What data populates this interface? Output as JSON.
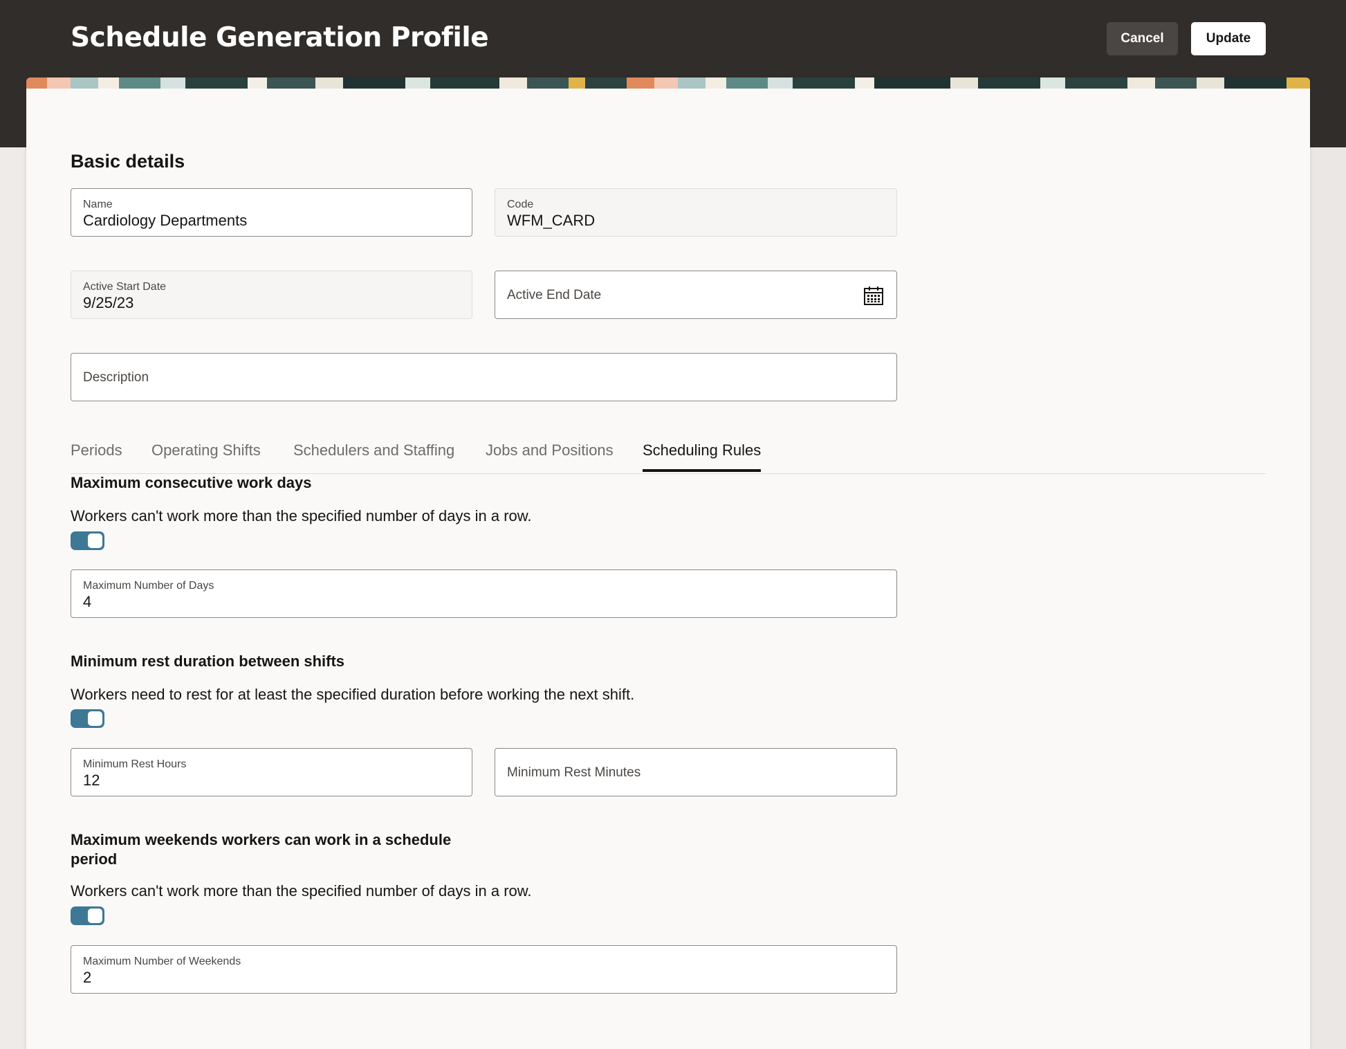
{
  "header": {
    "title": "Schedule Generation Profile",
    "cancel_label": "Cancel",
    "update_label": "Update"
  },
  "basic_details": {
    "title": "Basic details",
    "name": {
      "label": "Name",
      "value": "Cardiology Departments"
    },
    "code": {
      "label": "Code",
      "value": "WFM_CARD"
    },
    "active_start_date": {
      "label": "Active Start Date",
      "value": "9/25/23"
    },
    "active_end_date": {
      "placeholder": "Active End Date"
    },
    "description": {
      "placeholder": "Description"
    }
  },
  "tabs": [
    {
      "label": "Periods"
    },
    {
      "label": "Operating Shifts"
    },
    {
      "label": "Schedulers and Staffing"
    },
    {
      "label": "Jobs and Positions"
    },
    {
      "label": "Scheduling Rules",
      "active": true
    }
  ],
  "rules": {
    "max_consecutive": {
      "title": "Maximum consecutive work days",
      "description": "Workers can't work more than the specified number of days in a row.",
      "enabled": true,
      "field_label": "Maximum Number of Days",
      "field_value": "4"
    },
    "min_rest": {
      "title": "Minimum rest duration between shifts",
      "description": "Workers need to rest for at least the specified duration before working the next shift.",
      "enabled": true,
      "hours_label": "Minimum Rest Hours",
      "hours_value": "12",
      "minutes_placeholder": "Minimum Rest Minutes"
    },
    "max_weekends": {
      "title_line1": "Maximum weekends workers can work in a schedule",
      "title_line2": "period",
      "description": "Workers can't work more than the specified number of days in a row.",
      "enabled": true,
      "field_label": "Maximum Number of Weekends",
      "field_value": "2"
    }
  },
  "colors": {
    "header_bg": "#312d2a",
    "toggle_on": "#3e7895",
    "card_bg": "#faf9f8"
  },
  "icons": {
    "calendar": "calendar-icon"
  }
}
